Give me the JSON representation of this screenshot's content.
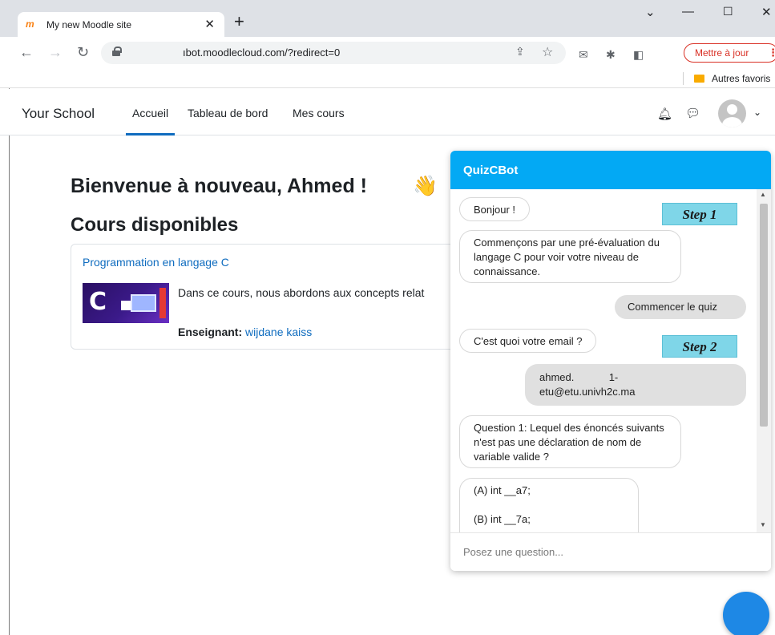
{
  "browser": {
    "tab_title": "My new Moodle site",
    "tab_favicon": "m",
    "url": "ıbot.moodlecloud.com/?redirect=0",
    "update_label": "Mettre à jour",
    "bookmark_folder": "Autres favoris"
  },
  "nav": {
    "brand": "Your School",
    "links": [
      "Accueil",
      "Tableau de bord",
      "Mes cours"
    ]
  },
  "main": {
    "welcome": "Bienvenue à nouveau, Ahmed !",
    "courses_heading": "Cours disponibles",
    "course": {
      "title": "Programmation en langage C",
      "image_letter": "C",
      "description": "Dans ce cours, nous abordons aux concepts relat",
      "teacher_label": "Enseignant:",
      "teacher_name": "wijdane kaiss"
    }
  },
  "chatbot": {
    "title": "QuizCBot",
    "messages": [
      "Bonjour !",
      "Commençons par une pré-évaluation du langage C pour voir votre niveau de connaissance.",
      "Commencer le quiz",
      "C'est quoi votre email ?",
      "ahmed.            1-\netu@etu.univh2c.ma",
      "Question 1: Lequel des énoncés suivants n'est pas une déclaration de nom de variable valide ?",
      "(A) int __a7;\n\n(B) int __7a;"
    ],
    "steps": [
      "Step 1",
      "Step 2"
    ],
    "input_placeholder": "Posez une question..."
  },
  "colors": {
    "chat_header": "#03a9f4",
    "moodle_link": "#0f6cbf",
    "step_badge": "#7fd6e8",
    "update_red": "#d93025"
  }
}
